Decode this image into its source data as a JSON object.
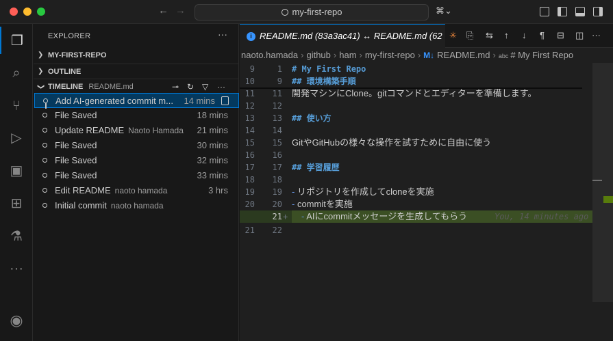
{
  "window": {
    "title": "my-first-repo",
    "nav_back": "←",
    "nav_forward": "→",
    "copilot_label": "⌘⌄"
  },
  "activity_bar": {
    "items": [
      {
        "name": "explorer-icon",
        "glyph": "❐"
      },
      {
        "name": "search-icon",
        "glyph": "⌕"
      },
      {
        "name": "source-control-icon",
        "glyph": "⑂"
      },
      {
        "name": "run-debug-icon",
        "glyph": "▷"
      },
      {
        "name": "remote-explorer-icon",
        "glyph": "▣"
      },
      {
        "name": "extensions-icon",
        "glyph": "⊞"
      },
      {
        "name": "testing-icon",
        "glyph": "⚗"
      },
      {
        "name": "more-icon",
        "glyph": "···"
      }
    ],
    "account_glyph": "◉"
  },
  "sidebar": {
    "title": "EXPLORER",
    "more": "···",
    "sections": {
      "repo": "MY-FIRST-REPO",
      "outline": "OUTLINE",
      "timeline": "TIMELINE",
      "timeline_file": "README.md"
    },
    "timeline_items": [
      {
        "label": "Add AI-generated commit m...",
        "author": "",
        "time": "14 mins",
        "selected": true
      },
      {
        "label": "File Saved",
        "author": "",
        "time": "18 mins"
      },
      {
        "label": "Update README",
        "author": "Naoto Hamada",
        "time": "21 mins"
      },
      {
        "label": "File Saved",
        "author": "",
        "time": "30 mins"
      },
      {
        "label": "File Saved",
        "author": "",
        "time": "32 mins"
      },
      {
        "label": "File Saved",
        "author": "",
        "time": "33 mins"
      },
      {
        "label": "Edit README",
        "author": "naoto hamada",
        "time": "3 hrs"
      },
      {
        "label": "Initial commit",
        "author": "naoto hamada",
        "time": ""
      }
    ]
  },
  "editor": {
    "tab_title": "README.md (83a3ac41) ↔ README.md (62",
    "tab_info": "i",
    "breadcrumbs": [
      "naoto.hamada",
      "github",
      "ham",
      "my-first-repo",
      "README.md",
      "# My First Repo"
    ],
    "breadcrumb_md": "M↓",
    "breadcrumb_abc": "abc",
    "lines": [
      {
        "old": "9",
        "new": "1",
        "text": "# My First Repo",
        "kind": "heading",
        "sticky": true
      },
      {
        "old": "10",
        "new": "9",
        "text": "## 環境構築手順",
        "kind": "heading",
        "sticky": true
      },
      {
        "old": "11",
        "new": "11",
        "text": "開発マシンにClone。gitコマンドとエディターを準備します。",
        "kind": "text"
      },
      {
        "old": "12",
        "new": "12",
        "text": "",
        "kind": "text"
      },
      {
        "old": "13",
        "new": "13",
        "text": "## 使い方",
        "kind": "heading"
      },
      {
        "old": "14",
        "new": "14",
        "text": "",
        "kind": "text"
      },
      {
        "old": "15",
        "new": "15",
        "text": "GitやGitHubの様々な操作を試すために自由に使う",
        "kind": "text"
      },
      {
        "old": "16",
        "new": "16",
        "text": "",
        "kind": "text"
      },
      {
        "old": "17",
        "new": "17",
        "text": "## 学習履歴",
        "kind": "heading"
      },
      {
        "old": "18",
        "new": "18",
        "text": "",
        "kind": "text"
      },
      {
        "old": "19",
        "new": "19",
        "text": "- リポジトリを作成してcloneを実施",
        "kind": "bullet"
      },
      {
        "old": "20",
        "new": "20",
        "text": "- commitを実施",
        "kind": "bullet"
      },
      {
        "old": "",
        "new": "21",
        "text": "- AIにcommitメッセージを生成してもらう",
        "kind": "added",
        "plus": "+",
        "blame": "You, 14 minutes ago"
      },
      {
        "old": "21",
        "new": "22",
        "text": "",
        "kind": "text"
      }
    ]
  },
  "colors": {
    "accent": "#0078d4",
    "added_line": "#3b4f24",
    "heading": "#569cd6"
  }
}
